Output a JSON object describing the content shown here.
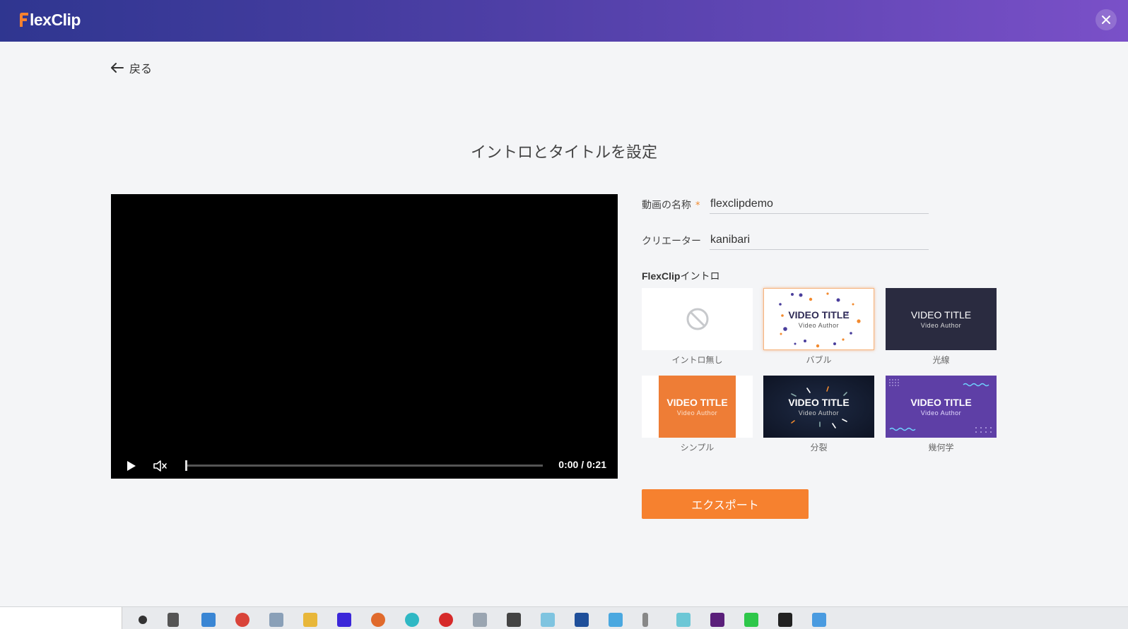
{
  "header": {
    "logo_text": "lexClip",
    "logo_accent": "#f6812f"
  },
  "nav": {
    "back_label": "戻る"
  },
  "page": {
    "title": "イントロとタイトルを設定"
  },
  "player": {
    "time": "0:00 / 0:21",
    "progress": 0
  },
  "form": {
    "name_label": "動画の名称",
    "name_required_mark": "*",
    "name_value": "flexclipdemo",
    "creator_label": "クリエーター",
    "creator_value": "kanibari"
  },
  "intro": {
    "heading_brand": "FlexClip",
    "heading_suffix": "イントロ",
    "options": [
      {
        "caption": "イントロ無し",
        "icon": "no-icon"
      },
      {
        "caption": "バブル",
        "title": "VIDEO TITLE",
        "author": "Video Author",
        "selected": true
      },
      {
        "caption": "光線",
        "title": "VIDEO TITLE",
        "author": "Video Author"
      },
      {
        "caption": "シンプル",
        "title": "VIDEO TITLE",
        "author": "Video Author"
      },
      {
        "caption": "分裂",
        "title": "VIDEO TITLE",
        "author": "Video Author"
      },
      {
        "caption": "幾何学",
        "title": "VIDEO TITLE",
        "author": "Video Author"
      }
    ]
  },
  "actions": {
    "export_label": "エクスポート",
    "export_color": "#f6812f"
  }
}
